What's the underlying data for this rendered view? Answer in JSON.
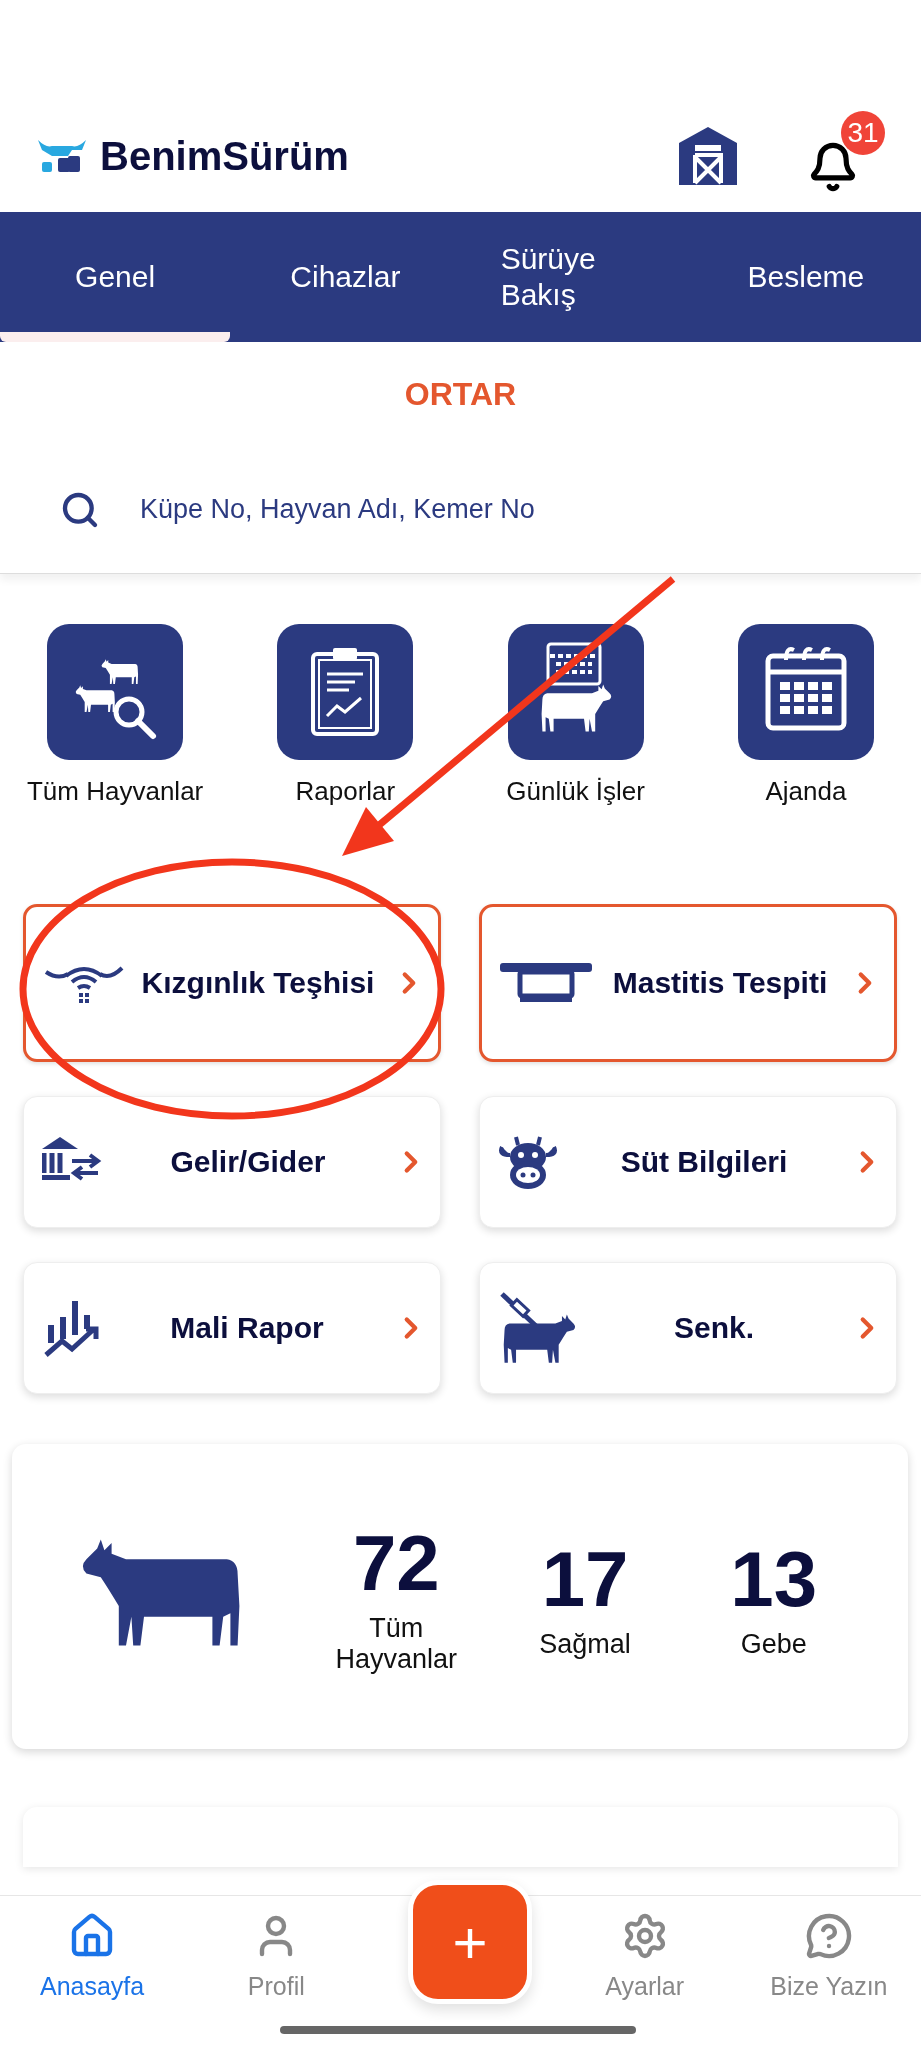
{
  "header": {
    "title": "BenimSürüm",
    "notification_count": "31"
  },
  "tabs": [
    {
      "label": "Genel",
      "selected": true
    },
    {
      "label": "Cihazlar",
      "selected": false
    },
    {
      "label": "Sürüye Bakış",
      "selected": false
    },
    {
      "label": "Besleme",
      "selected": false
    }
  ],
  "farm": "ORTAR",
  "search": {
    "placeholder": "Küpe No, Hayvan Adı, Kemer No"
  },
  "shortcuts": [
    {
      "kind": "animals",
      "label": "Tüm Hayvanlar"
    },
    {
      "kind": "report",
      "label": "Raporlar"
    },
    {
      "kind": "daily",
      "label": "Günlük İşler"
    },
    {
      "kind": "calendar",
      "label": "Ajanda"
    }
  ],
  "cards": [
    {
      "kind": "heat",
      "label": "Kızgınlık Teşhisi",
      "highlighted": true
    },
    {
      "kind": "mastitis",
      "label": "Mastitis Tespiti",
      "highlighted": true
    },
    {
      "kind": "finance",
      "label": "Gelir/Gider",
      "highlighted": false
    },
    {
      "kind": "milk",
      "label": "Süt Bilgileri",
      "highlighted": false
    },
    {
      "kind": "chart",
      "label": "Mali Rapor",
      "highlighted": false
    },
    {
      "kind": "sync",
      "label": "Senk.",
      "highlighted": false
    }
  ],
  "stats": [
    {
      "value": "72",
      "label": "Tüm Hayvanlar"
    },
    {
      "value": "17",
      "label": "Sağmal"
    },
    {
      "value": "13",
      "label": "Gebe"
    }
  ],
  "fab": "+",
  "nav": [
    {
      "kind": "home",
      "label": "Anasayfa",
      "selected": true
    },
    {
      "kind": "profile",
      "label": "Profil",
      "selected": false
    },
    {
      "kind": "settings",
      "label": "Ayarlar",
      "selected": false
    },
    {
      "kind": "help",
      "label": "Bize Yazın",
      "selected": false
    }
  ]
}
